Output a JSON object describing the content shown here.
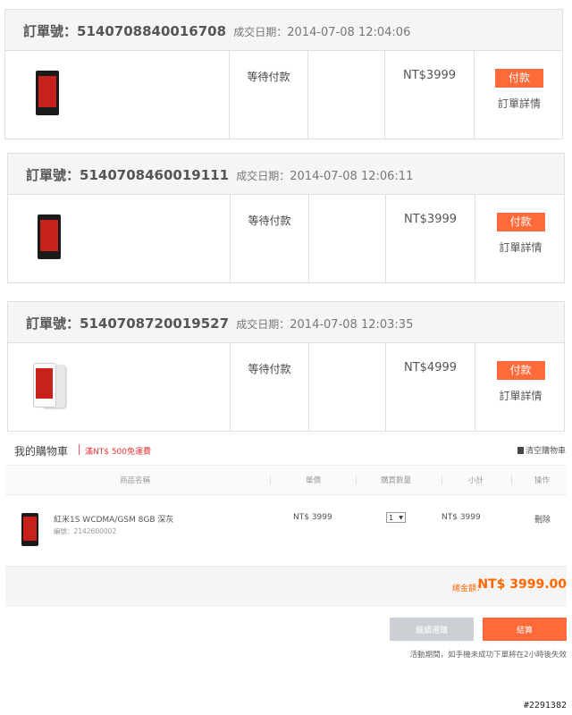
{
  "orders": [
    {
      "number_label": "訂單號：",
      "number": "5140708840016708",
      "date_label": "成交日期：",
      "date": "2014-07-08 12:04:06",
      "status": "等待付款",
      "price": "NT$3999",
      "pay_label": "付款",
      "detail_label": "訂單詳情"
    },
    {
      "number_label": "訂單號：",
      "number": "5140708460019111",
      "date_label": "成交日期：",
      "date": "2014-07-08 12:06:11",
      "status": "等待付款",
      "price": "NT$3999",
      "pay_label": "付款",
      "detail_label": "訂單詳情"
    },
    {
      "number_label": "訂單號：",
      "number": "5140708720019527",
      "date_label": "成交日期：",
      "date": "2014-07-08 12:03:35",
      "status": "等待付款",
      "price": "NT$4999",
      "pay_label": "付款",
      "detail_label": "訂單詳情"
    }
  ],
  "cart": {
    "title": "我的購物車",
    "promo": "滿NT$ 500免運費",
    "clear_label": "清空購物車",
    "columns": [
      "商品名稱",
      "單價",
      "購買數量",
      "小計",
      "操作"
    ],
    "item": {
      "name": "紅米1S WCDMA/GSM 8GB 深灰",
      "code": "編號：2142600002",
      "unit_price": "NT$ 3999",
      "quantity": "1",
      "subtotal": "NT$ 3999",
      "delete_label": "刪除"
    },
    "total_label": "總金額：",
    "total_value": "NT$ 3999.00",
    "continue_label": "繼續選購",
    "checkout_label": "結算",
    "notice": "活動期間，如手機未成功下單將在2小時後失效"
  },
  "watermark": "#2291382",
  "colors": {
    "accent": "#ff6a3a",
    "price_orange": "#ff6700",
    "promo_red": "#e83535"
  }
}
